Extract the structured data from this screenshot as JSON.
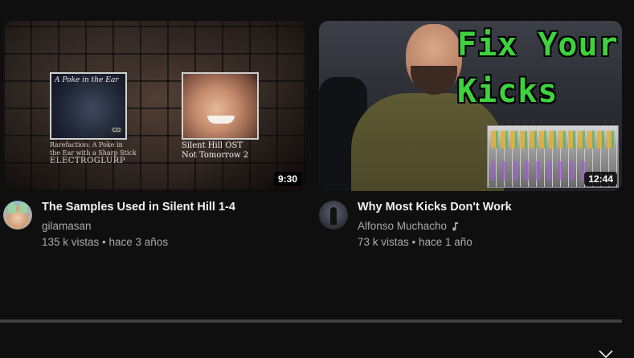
{
  "videos": [
    {
      "title": "The Samples Used in Silent Hill 1-4",
      "channel": "gilamasan",
      "stats": "135 k vistas • hace 3 años",
      "duration": "9:30",
      "thumbnail": {
        "left_art_title": "A Poke in the Ear",
        "left_art_badge": "CD",
        "left_caption_line1": "Rarefaction: A Poke in",
        "left_caption_line2": "the Ear with a Sharp Stick",
        "left_caption_line3": "ELECTROGLURP",
        "right_caption_line1": "Silent Hill OST",
        "right_caption_line2": "Not Tomorrow 2"
      }
    },
    {
      "title": "Why Most Kicks Don't Work",
      "channel": "Alfonso Muchacho",
      "channel_badge_icon": "music-note-icon",
      "stats": "73 k vistas • hace 1 año",
      "duration": "12:44",
      "thumbnail": {
        "overlay_line1": "Fix Your",
        "overlay_line2": "Kicks"
      }
    }
  ],
  "colors": {
    "background": "#0f0f0f",
    "title": "#f1f1f1",
    "secondary_text": "#aaaaaa",
    "overlay_green": "#3fd23f",
    "divider": "#3f3f3f"
  }
}
